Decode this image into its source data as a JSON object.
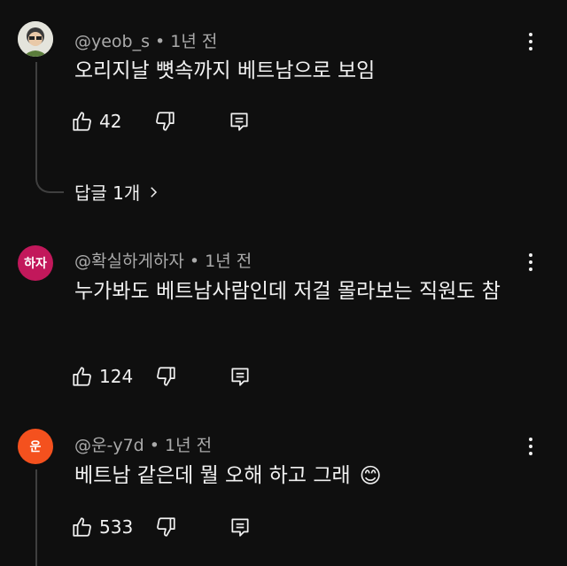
{
  "comments": [
    {
      "avatar_text": "",
      "avatar_color": "#d8d8d0",
      "meta": "@yeob_s • 1년 전",
      "text": "오리지날 뼛속까지 베트남으로 보임",
      "likes": "42",
      "replies": "답글 1개"
    },
    {
      "avatar_text": "하자",
      "avatar_color": "#c2185b",
      "meta": "@확실하게하자 • 1년 전",
      "text": "누가봐도 베트남사람인데 저걸 몰라보는 직원도 참",
      "likes": "124"
    },
    {
      "avatar_text": "운",
      "avatar_color": "#f4511e",
      "meta": "@운-y7d • 1년 전",
      "text": "베트남 같은데 뭘 오해 하고 그래",
      "emoji": "😊",
      "likes": "533"
    }
  ],
  "icons": [
    "thumbs-up-icon",
    "thumbs-down-icon",
    "reply-icon",
    "more-vert-icon",
    "chevron-right-icon"
  ]
}
